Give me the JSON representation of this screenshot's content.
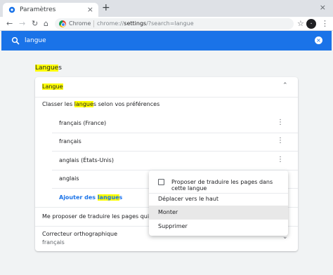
{
  "browser": {
    "tab_title": "Paramètres",
    "new_tab": "+",
    "tab_close": "×",
    "minimize": "×",
    "back": "←",
    "forward": "→",
    "reload": "↻",
    "home": "⌂",
    "site_chip": "Chrome",
    "url_host": "chrome://",
    "url_strong": "settings",
    "url_rest": "/?search=langue",
    "star": "☆",
    "avatar_text": "•",
    "menu": "⋮"
  },
  "search": {
    "query": "langue",
    "clear": "×"
  },
  "section": {
    "title_hl": "Langue",
    "title_rest": "s"
  },
  "card": {
    "header_hl": "Langue",
    "order_pre": "Classer les ",
    "order_hl": "langue",
    "order_post": "s selon vos préférences",
    "languages": [
      "français (France)",
      "français",
      "anglais (États-Unis)",
      "anglais"
    ],
    "add_pre": "Ajouter des ",
    "add_hl": "langue",
    "add_post": "s",
    "translate_offer": "Me proposer de traduire les pages qui sont écrit",
    "spellcheck_title": "Correcteur orthographique",
    "spellcheck_value": "français",
    "more": "⋮",
    "chevron_up": "⌃",
    "chevron_down": "⌄"
  },
  "popup": {
    "offer_translate": "Proposer de traduire les pages dans cette langue",
    "move_top": "Déplacer vers le haut",
    "move_up": "Monter",
    "remove": "Supprimer"
  },
  "colors": {
    "accent": "#1a73e8",
    "highlight": "#ffff00"
  }
}
